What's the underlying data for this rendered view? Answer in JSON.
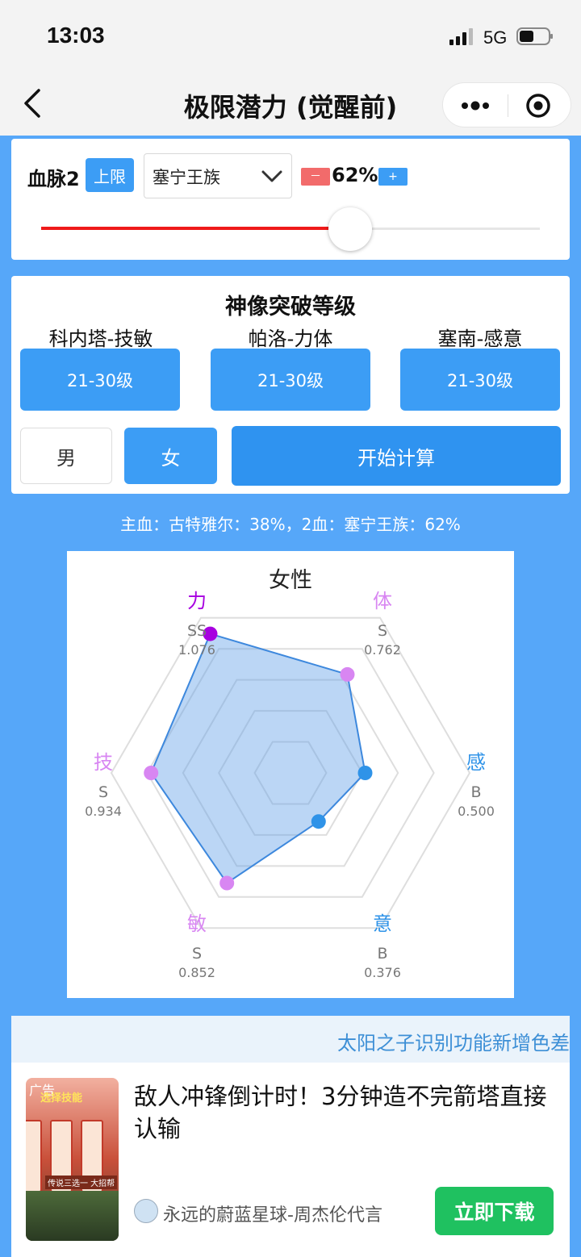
{
  "status_bar": {
    "time": "13:03",
    "network": "5G"
  },
  "nav": {
    "title": "极限潜力 (觉醒前)"
  },
  "bloodline": {
    "label": "血脉2",
    "limit_button": "上限",
    "selected_clan": "塞宁王族",
    "minus": "－",
    "percent_text": "62%",
    "plus": "+",
    "slider_value": 0.62
  },
  "breakthrough": {
    "title": "神像突破等级",
    "items": [
      {
        "label": "科内塔-技敏",
        "level": "21-30级"
      },
      {
        "label": "帕洛-力体",
        "level": "21-30级"
      },
      {
        "label": "塞南-感意",
        "level": "21-30级"
      }
    ],
    "gender_male": "男",
    "gender_female": "女",
    "calculate": "开始计算"
  },
  "summary": "主血：古特雅尔：38%，2血：塞宁王族：62%",
  "chart_data": {
    "type": "radar",
    "title": "女性",
    "axes": [
      {
        "name": "力",
        "grade": "SS",
        "value": 1.076,
        "value_text": "1.076",
        "color": "#a700e0"
      },
      {
        "name": "体",
        "grade": "S",
        "value": 0.762,
        "value_text": "0.762",
        "color": "#d886f2"
      },
      {
        "name": "感",
        "grade": "B",
        "value": 0.5,
        "value_text": "0.500",
        "color": "#2f93e8"
      },
      {
        "name": "意",
        "grade": "B",
        "value": 0.376,
        "value_text": "0.376",
        "color": "#2f93e8"
      },
      {
        "name": "敏",
        "grade": "S",
        "value": 0.852,
        "value_text": "0.852",
        "color": "#d886f2"
      },
      {
        "name": "技",
        "grade": "S",
        "value": 0.934,
        "value_text": "0.934",
        "color": "#d886f2"
      }
    ],
    "max": 1.2,
    "rings": 5,
    "fill_color": "#5c9ee8",
    "stroke_color": "#3d88dd"
  },
  "ad": {
    "marquee": "太阳之子识别功能新增色差",
    "badge": "广告",
    "thumb_title": "选择技能",
    "thumb_caption": "传说三选一 大招帮",
    "title": "敌人冲锋倒计时！3分钟造不完箭塔直接认输",
    "author": "永远的蔚蓝星球-周杰伦代言",
    "download": "立即下载"
  },
  "colors": {
    "background": "#56a7f9",
    "primary": "#3c9df5",
    "danger": "#f26b6b",
    "download": "#1fc160"
  }
}
